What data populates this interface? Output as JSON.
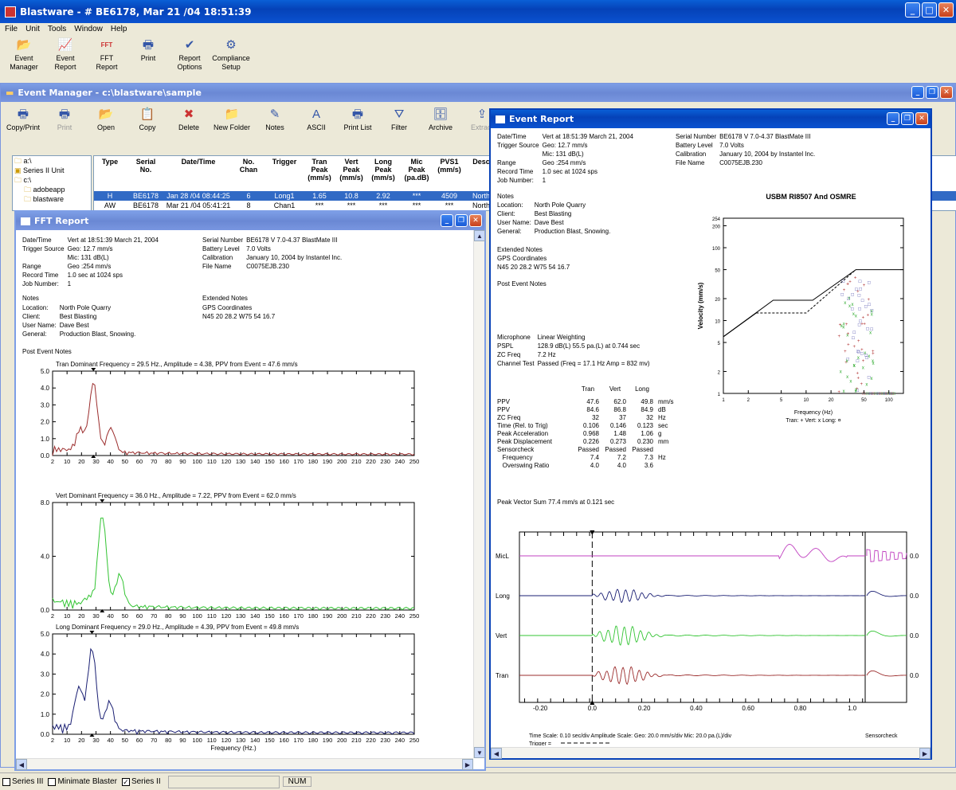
{
  "app": {
    "title": "Blastware - # BE6178, Mar 21 /04 18:51:39",
    "menu": [
      "File",
      "Unit",
      "Tools",
      "Window",
      "Help"
    ],
    "toolbar": [
      {
        "icon": "event-manager-icon",
        "label": "Event\nManager"
      },
      {
        "icon": "event-report-icon",
        "label": "Event\nReport"
      },
      {
        "icon": "fft-report-icon",
        "label": "FFT\nReport"
      },
      {
        "icon": "print-icon",
        "label": "Print"
      },
      {
        "icon": "report-options-icon",
        "label": "Report\nOptions"
      },
      {
        "icon": "compliance-setup-icon",
        "label": "Compliance\nSetup"
      }
    ]
  },
  "event_manager": {
    "title": "Event Manager - c:\\blastware\\sample",
    "toolbar": [
      "Copy/Print",
      "Print",
      "Open",
      "Copy",
      "Delete",
      "New Folder",
      "Notes",
      "ASCII",
      "Print List",
      "Filter",
      "Archive",
      "Extract"
    ],
    "tree": [
      "a:\\",
      "Series II Unit",
      "c:\\",
      "adobeapp",
      "blastware"
    ],
    "columns": [
      "Type",
      "Serial\nNo.",
      "Date/Time",
      "No.\nChan",
      "Trigger",
      "Tran\nPeak\n(mm/s)",
      "Vert\nPeak\n(mm/s)",
      "Long\nPeak\n(mm/s)",
      "Mic\nPeak\n(pa.dB)",
      "PVS1\n(mm/s)",
      "Desc"
    ],
    "rows": [
      [
        "H",
        "BE6178",
        "Jan 28 /04 08:44:25",
        "6",
        "Long1",
        "1.65",
        "10.8",
        "2.92",
        "***",
        "4509",
        "North"
      ],
      [
        "AW",
        "BE6178",
        "Mar 21 /04 05:41:21",
        "8",
        "Chan1",
        "***",
        "***",
        "***",
        "***",
        "***",
        "North"
      ]
    ]
  },
  "fft": {
    "title": "FFT Report",
    "header_left": [
      [
        "Date/Time",
        "Vert at 18:51:39 March 21, 2004"
      ],
      [
        "Trigger Source",
        "Geo: 12.7 mm/s"
      ],
      [
        "",
        "Mic: 131 dB(L)"
      ],
      [
        "Range",
        "Geo :254 mm/s"
      ],
      [
        "Record Time",
        "1.0 sec at 1024 sps"
      ],
      [
        "Job Number:",
        "1"
      ]
    ],
    "header_right": [
      [
        "Serial Number",
        "BE6178 V 7.0-4.37 BlastMate III"
      ],
      [
        "Battery Level",
        "7.0 Volts"
      ],
      [
        "Calibration",
        "January 10, 2004 by Instantel Inc."
      ],
      [
        "File Name",
        "C0075EJB.230"
      ]
    ],
    "notes_heading": "Notes",
    "notes": [
      [
        "Location:",
        "North Pole Quarry"
      ],
      [
        "Client:",
        "Best Blasting"
      ],
      [
        "User Name:",
        "Dave Best"
      ],
      [
        "General:",
        "Production Blast, Snowing."
      ]
    ],
    "ext_heading": "Extended Notes",
    "ext": [
      "GPS Coordinates",
      "N45 20 28.2 W75 54 16.7"
    ],
    "post": "Post Event Notes",
    "graphs": [
      {
        "title": "Tran Dominant Frequency = 29.5 Hz., Amplitude = 4.38,  PPV from Event = 47.6 mm/s",
        "color": "#9b2c2c",
        "yticks": [
          "5.0",
          "4.0",
          "3.0",
          "2.0",
          "1.0",
          "0.0"
        ]
      },
      {
        "title": "Vert Dominant Frequency = 36.0 Hz., Amplitude = 7.22,  PPV from Event = 62.0 mm/s",
        "color": "#33c433",
        "yticks": [
          "8.0",
          "4.0",
          "0.0"
        ]
      },
      {
        "title": "Long Dominant Frequency = 29.0 Hz., Amplitude = 4.39,  PPV from Event = 49.8 mm/s",
        "color": "#1a1f73",
        "yticks": [
          "5.0",
          "4.0",
          "3.0",
          "2.0",
          "1.0",
          "0.0"
        ]
      }
    ],
    "xticks": [
      "2",
      "10",
      "20",
      "30",
      "40",
      "50",
      "60",
      "70",
      "80",
      "90",
      "100",
      "110",
      "120",
      "130",
      "140",
      "150",
      "160",
      "170",
      "180",
      "190",
      "200",
      "210",
      "220",
      "230",
      "240",
      "250"
    ],
    "xlabel": "Frequency (Hz.)"
  },
  "event_report": {
    "title": "Event Report",
    "header_left": [
      [
        "Date/Time",
        "Vert at 18:51:39 March 21, 2004"
      ],
      [
        "Trigger Source",
        "Geo: 12.7 mm/s"
      ],
      [
        "",
        "Mic: 131 dB(L)"
      ],
      [
        "Range",
        "Geo :254 mm/s"
      ],
      [
        "Record Time",
        "1.0 sec at 1024 sps"
      ],
      [
        "Job Number:",
        "1"
      ]
    ],
    "header_right": [
      [
        "Serial Number",
        "BE6178 V 7.0-4.37 BlastMate III"
      ],
      [
        "Battery Level",
        "7.0 Volts"
      ],
      [
        "Calibration",
        "January 10, 2004 by Instantel Inc."
      ],
      [
        "File Name",
        "C0075EJB.230"
      ]
    ],
    "notes_heading": "Notes",
    "notes": [
      [
        "Location:",
        "North Pole Quarry"
      ],
      [
        "Client:",
        "Best Blasting"
      ],
      [
        "User Name:",
        "Dave Best"
      ],
      [
        "General:",
        "Production Blast, Snowing."
      ]
    ],
    "ext_heading": "Extended Notes",
    "ext": [
      "GPS Coordinates",
      "N45 20 28.2 W75 54 16.7"
    ],
    "post": "Post Event Notes",
    "mic": [
      [
        "Microphone",
        "Linear Weighting"
      ],
      [
        "PSPL",
        "128.9 dB(L)  55.5 pa.(L) at 0.744 sec"
      ],
      [
        "ZC Freq",
        "7.2 Hz"
      ],
      [
        "Channel Test",
        "Passed (Freq = 17.1 Hz Amp = 832 mv)"
      ]
    ],
    "table_cols": [
      "",
      "Tran",
      "Vert",
      "Long",
      ""
    ],
    "table": [
      [
        "PPV",
        "47.6",
        "62.0",
        "49.8",
        "mm/s"
      ],
      [
        "PPV",
        "84.6",
        "86.8",
        "84.9",
        "dB"
      ],
      [
        "ZC Freq",
        "32",
        "37",
        "32",
        "Hz"
      ],
      [
        "Time (Rel. to Trig)",
        "0.106",
        "0.146",
        "0.123",
        "sec"
      ],
      [
        "Peak Acceleration",
        "0.968",
        "1.48",
        "1.06",
        "g"
      ],
      [
        "Peak Displacement",
        "0.226",
        "0.273",
        "0.230",
        "mm"
      ],
      [
        "Sensorcheck",
        "Passed",
        "Passed",
        "Passed",
        ""
      ],
      [
        "   Frequency",
        "7.4",
        "7.2",
        "7.3",
        "Hz"
      ],
      [
        "   Overswing Ratio",
        "4.0",
        "4.0",
        "3.6",
        ""
      ]
    ],
    "pvs": "Peak Vector Sum  77.4 mm/s at 0.121 sec",
    "usbm_title": "USBM RI8507 And OSMRE",
    "usbm_ylabel": "Velocity (mm/s)",
    "usbm_xlabel": "Frequency (Hz)",
    "usbm_legend": "Tran: +  Vert: x  Long: ¤",
    "usbm_yticks": [
      "254",
      "200",
      "100",
      "50",
      "20",
      "10",
      "5",
      "2",
      "1"
    ],
    "usbm_xticks": [
      "1",
      "2",
      "5",
      "10",
      "20",
      "50",
      "100"
    ],
    "wave_channels": [
      "MicL",
      "Long",
      "Vert",
      "Tran"
    ],
    "wave_values": [
      "0.0",
      "0.0",
      "0.0",
      "0.0"
    ],
    "wave_xticks": [
      "-0.20",
      "0.0",
      "0.20",
      "0.40",
      "0.60",
      "0.80",
      "1.0"
    ],
    "footer": "Time Scale: 0.10 sec/div  Amplitude Scale: Geo: 20.0 mm/s/div Mic: 20.0 pa.(L)/div",
    "trigger": "Trigger =",
    "sensorcheck": "Sensorcheck"
  },
  "status": {
    "items": [
      "Series III",
      "Minimate Blaster",
      "Series II"
    ],
    "checked": [
      false,
      false,
      true
    ],
    "num": "NUM"
  }
}
